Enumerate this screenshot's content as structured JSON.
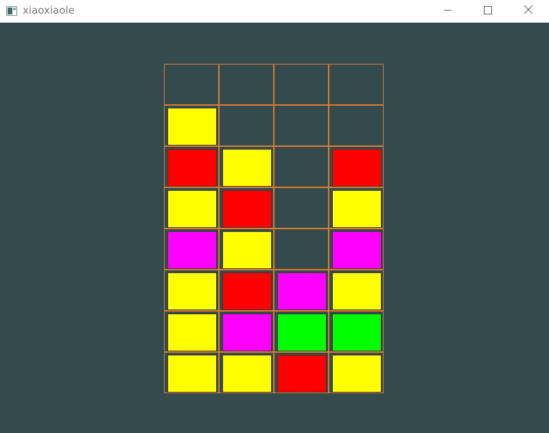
{
  "window": {
    "title": "xiaoxiaole",
    "icons": {
      "app": "app-window-icon",
      "minimize": "minimize-icon",
      "maximize": "maximize-icon",
      "close": "close-icon"
    }
  },
  "colors": {
    "background": "#344b4d",
    "grid_line": "#e07b2d",
    "yellow": "#ffff00",
    "red": "#ff0000",
    "magenta": "#ff00ff",
    "green": "#00ff00"
  },
  "board": {
    "columns": 4,
    "rows": 8,
    "grid": [
      [
        null,
        null,
        null,
        null
      ],
      [
        "yellow",
        null,
        null,
        null
      ],
      [
        "red",
        "yellow",
        null,
        "red"
      ],
      [
        "yellow",
        "red",
        null,
        "yellow"
      ],
      [
        "magenta",
        "yellow",
        null,
        "magenta"
      ],
      [
        "yellow",
        "red",
        "magenta",
        "yellow"
      ],
      [
        "yellow",
        "magenta",
        "green",
        "green"
      ],
      [
        "yellow",
        "yellow",
        "red",
        "yellow"
      ]
    ]
  }
}
